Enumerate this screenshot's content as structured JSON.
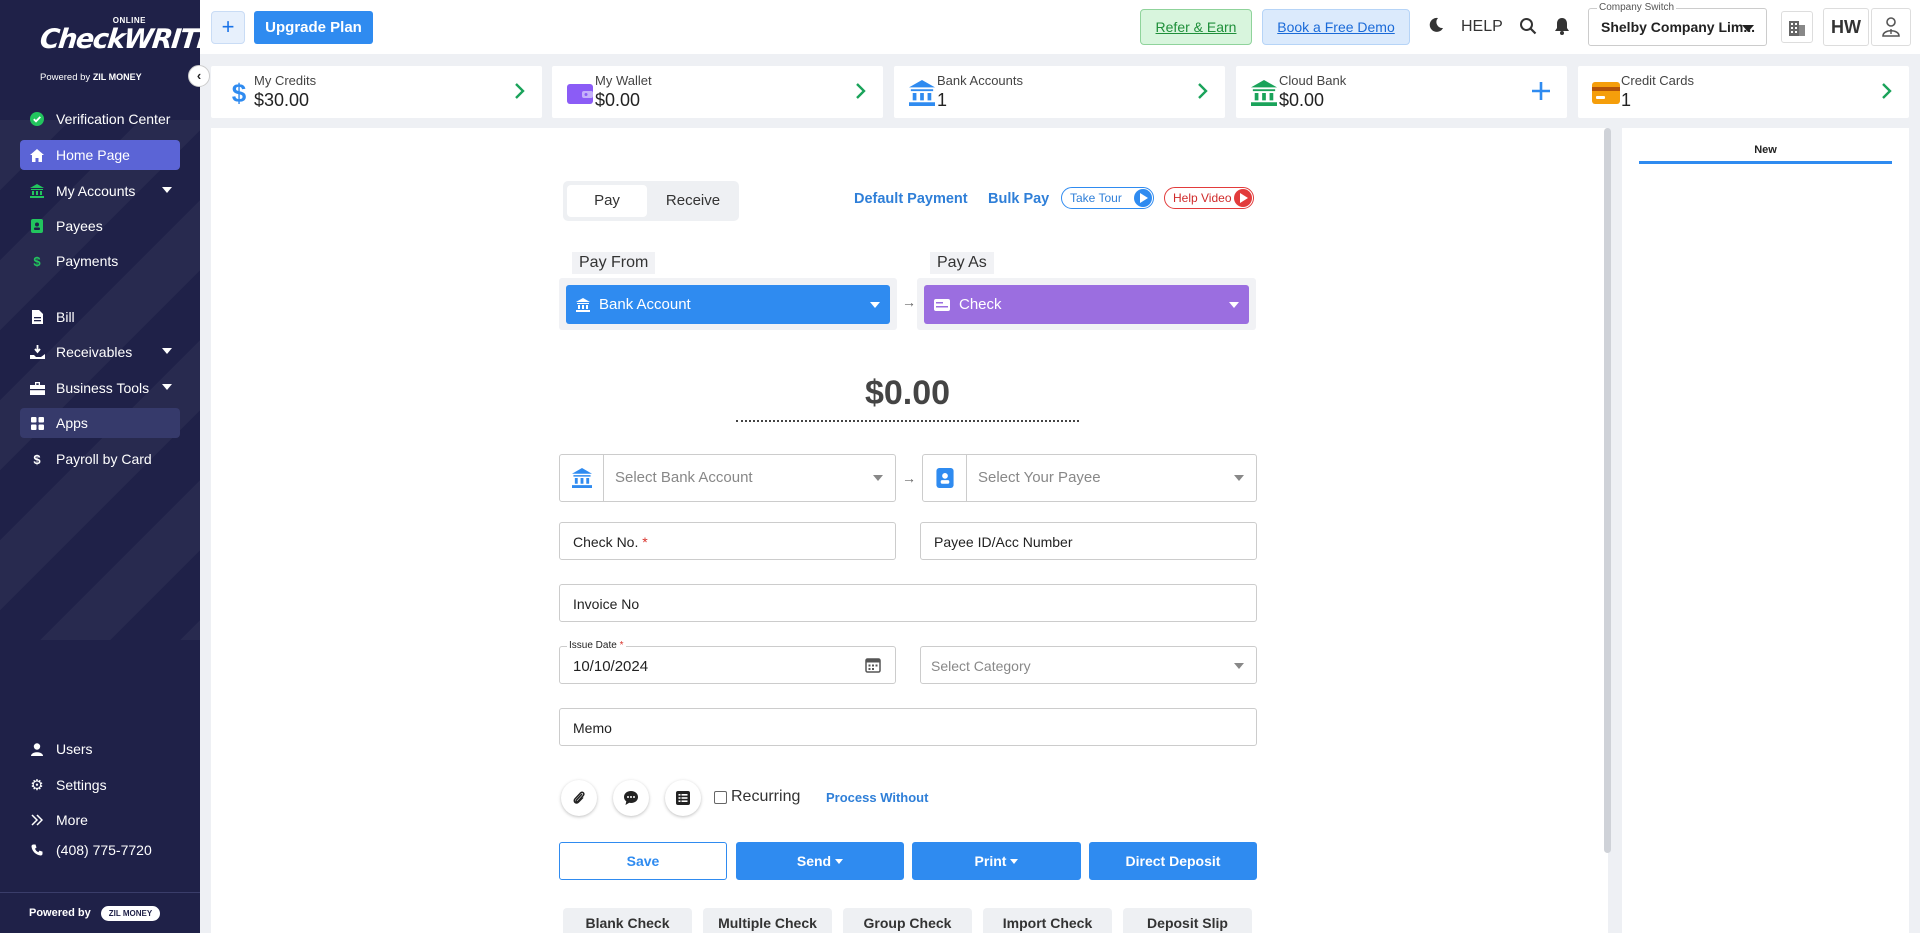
{
  "brand": {
    "online": "ONLINE",
    "name": "CheckWRITER",
    "powered": "Powered by",
    "zil": "ZIL MONEY"
  },
  "sidebar": {
    "items": [
      {
        "label": "Verification Center",
        "icon": "check-circle-icon"
      },
      {
        "label": "Home Page",
        "icon": "home-icon"
      },
      {
        "label": "My Accounts",
        "icon": "bank-icon"
      },
      {
        "label": "Payees",
        "icon": "payee-book-icon"
      },
      {
        "label": "Payments",
        "icon": "dollar-icon"
      },
      {
        "label": "Bill",
        "icon": "bill-icon"
      },
      {
        "label": "Receivables",
        "icon": "receivables-icon"
      },
      {
        "label": "Business Tools",
        "icon": "toolbox-icon"
      },
      {
        "label": "Apps",
        "icon": "apps-grid-icon"
      },
      {
        "label": "Payroll by Card",
        "icon": "dollar-icon"
      },
      {
        "label": "Users",
        "icon": "user-icon"
      },
      {
        "label": "Settings",
        "icon": "gear-icon"
      },
      {
        "label": "More",
        "icon": "double-chevron-icon"
      },
      {
        "label": "(408) 775-7720",
        "icon": "phone-icon"
      }
    ],
    "footer_powered": "Powered by",
    "footer_zil": "ZIL MONEY"
  },
  "topbar": {
    "upgrade": "Upgrade Plan",
    "refer": "Refer & Earn",
    "demo": "Book a Free Demo",
    "help": "HELP",
    "company_label": "Company Switch",
    "company_value": "Shelby Company Lim...",
    "avatar": "HW"
  },
  "cards": [
    {
      "title": "My Credits",
      "value": "$30.00",
      "color": "#2f8bf0"
    },
    {
      "title": "My Wallet",
      "value": "$0.00",
      "color": "#8b5cf6"
    },
    {
      "title": "Bank Accounts",
      "value": "1",
      "color": "#2f8bf0"
    },
    {
      "title": "Cloud Bank",
      "value": "$0.00",
      "color": "#1aa35a"
    },
    {
      "title": "Credit Cards",
      "value": "1",
      "color": "#f59e0b"
    }
  ],
  "right_panel": {
    "tab": "New"
  },
  "form": {
    "toggle": {
      "pay": "Pay",
      "receive": "Receive"
    },
    "default_payment": "Default Payment",
    "bulk_pay": "Bulk Pay",
    "take_tour": "Take Tour",
    "help_video": "Help Video",
    "pay_from_label": "Pay From",
    "pay_from_value": "Bank Account",
    "pay_as_label": "Pay As",
    "pay_as_value": "Check",
    "amount": "$0.00",
    "bank_account_placeholder": "Select Bank Account",
    "payee_placeholder": "Select Your Payee",
    "check_no": "Check No.",
    "required_mark": "*",
    "payee_id": "Payee ID/Acc Number",
    "invoice_no": "Invoice No",
    "issue_date_label": "Issue Date",
    "issue_date": "10/10/2024",
    "category_placeholder": "Select Category",
    "memo": "Memo",
    "recurring": "Recurring",
    "process_without": "Process Without"
  },
  "actions": {
    "save": "Save",
    "send": "Send",
    "print": "Print",
    "direct_deposit": "Direct Deposit"
  },
  "bottom_tabs": [
    "Blank Check",
    "Multiple Check",
    "Group Check",
    "Import Check",
    "Deposit Slip"
  ],
  "colors": {
    "primary": "#2f8bf0",
    "pay_as": "#9b6ee0",
    "sidebar": "#1f2148",
    "active_nav": "#5b64d6"
  }
}
